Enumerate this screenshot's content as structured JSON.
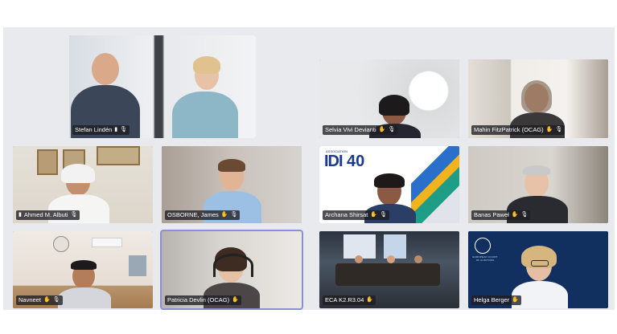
{
  "meeting": {
    "participants": [
      {
        "name": "Stefan Lindén",
        "mic": "muted",
        "camera": "on"
      },
      {
        "name": "Selvia Vivi Devianti",
        "mic": "muted",
        "camera": "on"
      },
      {
        "name": "Mahin FitzPatrick (OCAG)",
        "mic": "muted",
        "camera": "on"
      },
      {
        "name": "Ahmed M. Albuti",
        "mic": "muted",
        "camera": "on"
      },
      {
        "name": "OSBORNE, James",
        "mic": "muted",
        "camera": "on"
      },
      {
        "name": "Archana Shirsat",
        "mic": "muted",
        "camera": "on"
      },
      {
        "name": "Banas Paweł",
        "mic": "muted",
        "camera": "on"
      },
      {
        "name": "Navneet",
        "mic": "muted",
        "camera": "on"
      },
      {
        "name": "Patricia Devlin (OCAG)",
        "mic": "muted",
        "camera": "on",
        "active_speaker": true
      },
      {
        "name": "ECA K2.R3.04",
        "mic": "muted",
        "camera": "on"
      },
      {
        "name": "Helga Berger",
        "mic": "muted",
        "camera": "on"
      }
    ]
  },
  "branding": {
    "idi_logo": "IDI",
    "idi_logo_small": "ASSOCIATION",
    "idi_anniversary": "40",
    "eca_seal_text": "EUROPEAN COURT OF AUDITORS"
  },
  "colors": {
    "stage_bg": "#e9eaee",
    "label_bg": "#1e1e22",
    "active_outline": "#8d8fd6",
    "idi_blue": "#1b3a8a",
    "eca_navy": "#12305f"
  },
  "icons": {
    "mic_muted": "mic-off-icon",
    "signal": "signal-bars-icon",
    "reactions": "raise-hand-icon"
  }
}
